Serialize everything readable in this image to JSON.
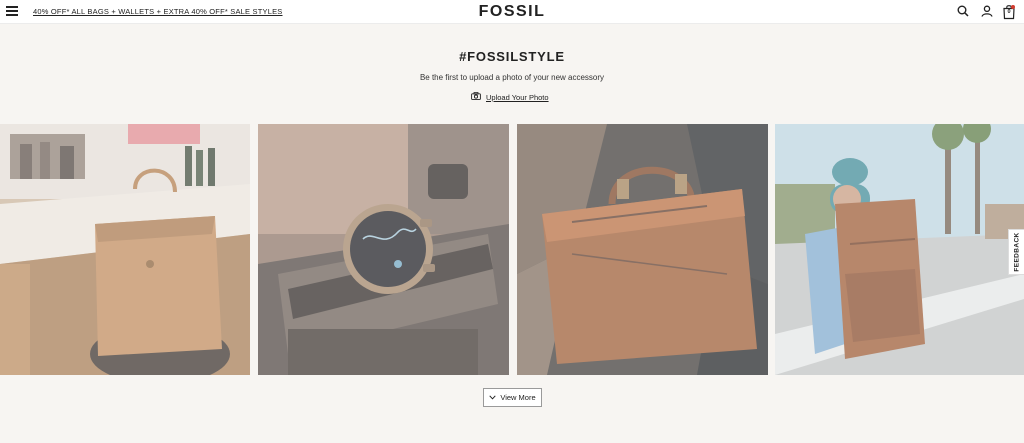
{
  "header": {
    "promo_text": "40% OFF* ALL BAGS + WALLETS + EXTRA 40% OFF* SALE STYLES",
    "logo": "FOSSIL",
    "bag_count": "0",
    "icons": [
      "menu-icon",
      "search-icon",
      "account-icon",
      "bag-icon"
    ]
  },
  "gallery": {
    "title": "#FOSSILSTYLE",
    "subtitle": "Be the first to upload a photo of your new accessory",
    "upload_label": "Upload Your Photo",
    "upload_icon": "camera-icon",
    "view_more_label": "View More",
    "view_more_icon": "chevron-down-icon"
  },
  "feedback": {
    "label": "FEEDBACK"
  },
  "colors": {
    "page_background": "#f7f5f2",
    "header_background": "#ffffff",
    "text": "#222222",
    "bag_badge": "#d23b2f"
  }
}
